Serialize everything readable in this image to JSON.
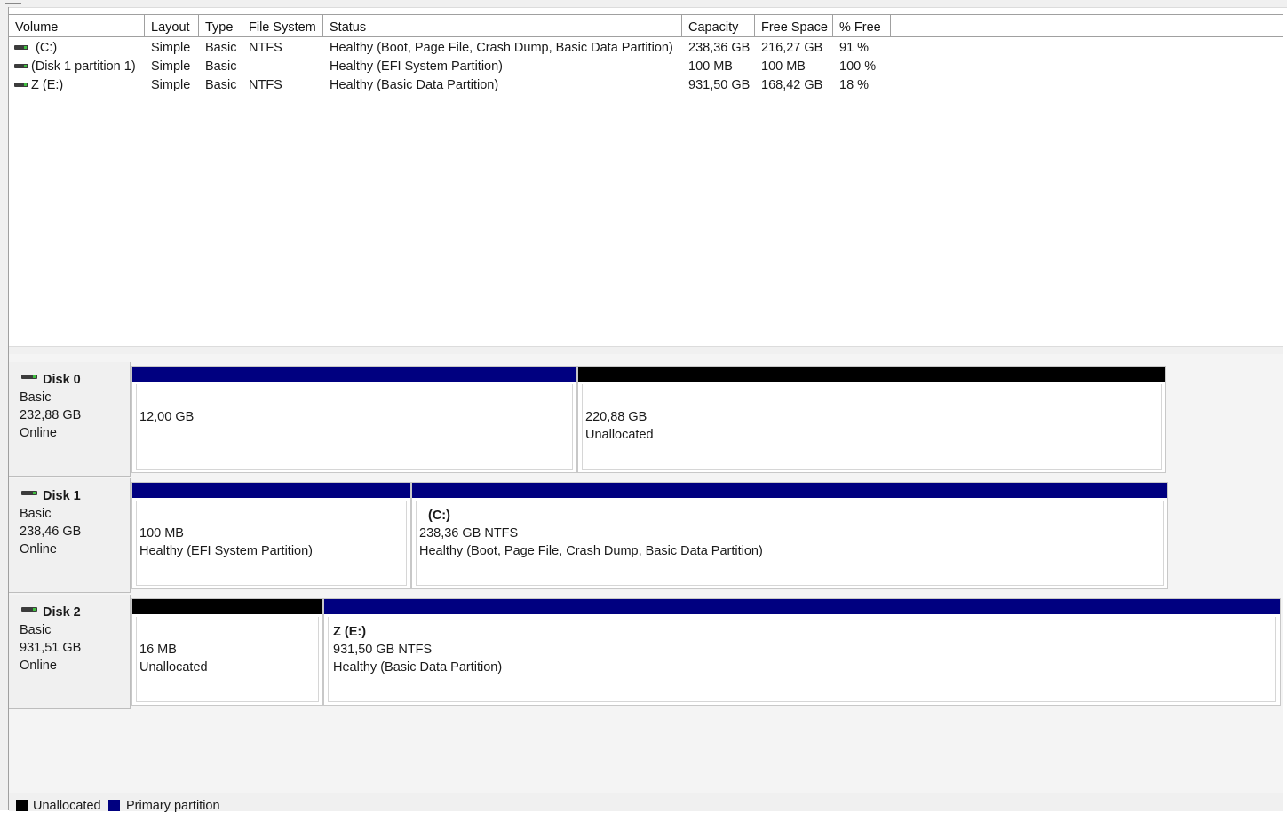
{
  "colors": {
    "primary": "#000080",
    "unallocated": "#000000",
    "border": "#a0a0a0"
  },
  "icons": {
    "volume": "drive-icon",
    "disk": "disk-drive-icon"
  },
  "columns": [
    "Volume",
    "Layout",
    "Type",
    "File System",
    "Status",
    "Capacity",
    "Free Space",
    "% Free"
  ],
  "volumes": [
    {
      "volume": "(C:)",
      "layout": "Simple",
      "type": "Basic",
      "fs": "NTFS",
      "status": "Healthy (Boot, Page File, Crash Dump, Basic Data Partition)",
      "capacity": "238,36 GB",
      "free": "216,27 GB",
      "pct": "91 %"
    },
    {
      "volume": "(Disk 1 partition 1)",
      "layout": "Simple",
      "type": "Basic",
      "fs": "",
      "status": "Healthy (EFI System Partition)",
      "capacity": "100 MB",
      "free": "100 MB",
      "pct": "100 %"
    },
    {
      "volume": "Z (E:)",
      "layout": "Simple",
      "type": "Basic",
      "fs": "NTFS",
      "status": "Healthy (Basic Data Partition)",
      "capacity": "931,50 GB",
      "free": "168,42 GB",
      "pct": "18 %"
    }
  ],
  "disks": [
    {
      "name": "Disk 0",
      "type": "Basic",
      "size": "232,88 GB",
      "status": "Online",
      "partitions": [
        {
          "kind": "primary",
          "title": "",
          "line1": "12,00 GB",
          "line2": ""
        },
        {
          "kind": "unallocated",
          "title": "",
          "line1": "220,88 GB",
          "line2": "Unallocated"
        }
      ]
    },
    {
      "name": "Disk 1",
      "type": "Basic",
      "size": "238,46 GB",
      "status": "Online",
      "partitions": [
        {
          "kind": "primary",
          "title": "",
          "line1": "100 MB",
          "line2": "Healthy (EFI System Partition)"
        },
        {
          "kind": "primary",
          "title": "(C:)",
          "line1": "238,36 GB NTFS",
          "line2": "Healthy (Boot, Page File, Crash Dump, Basic Data Partition)"
        }
      ]
    },
    {
      "name": "Disk 2",
      "type": "Basic",
      "size": "931,51 GB",
      "status": "Online",
      "partitions": [
        {
          "kind": "unallocated",
          "title": "",
          "line1": "16 MB",
          "line2": "Unallocated"
        },
        {
          "kind": "primary",
          "title": "Z  (E:)",
          "line1": "931,50 GB NTFS",
          "line2": "Healthy (Basic Data Partition)"
        }
      ]
    }
  ],
  "legend": [
    {
      "label": "Unallocated",
      "kind": "unallocated"
    },
    {
      "label": "Primary partition",
      "kind": "primary"
    }
  ]
}
